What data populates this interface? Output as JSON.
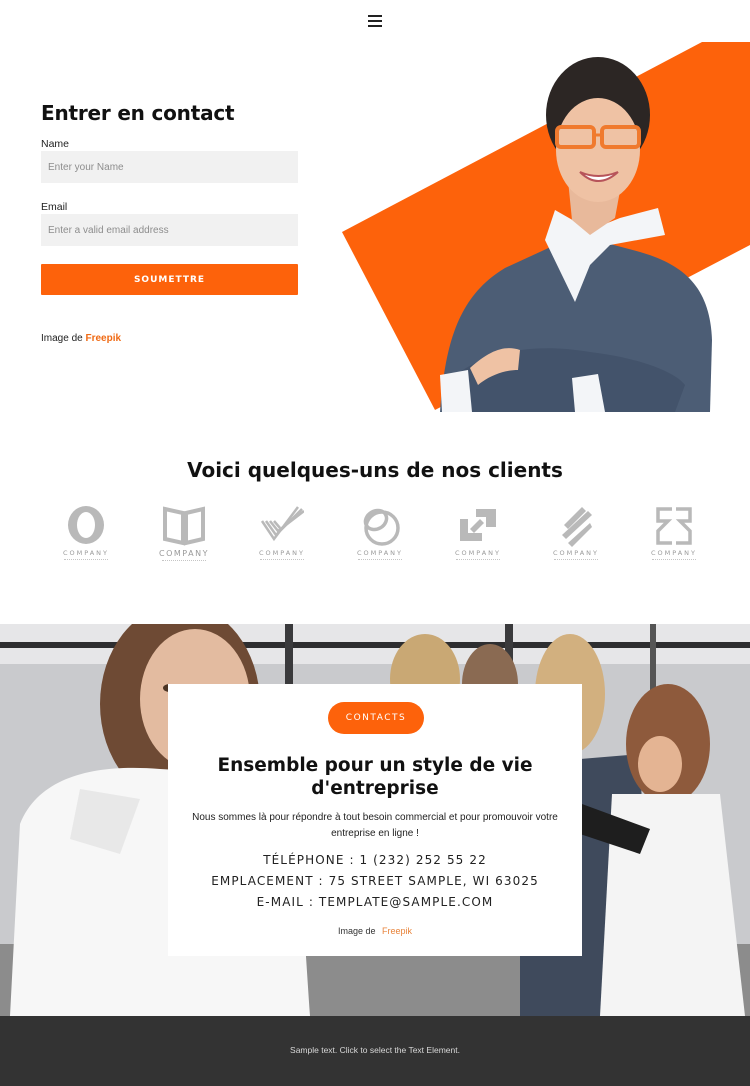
{
  "header": {
    "menu_icon": "hamburger-menu-icon"
  },
  "contact": {
    "title": "Entrer en contact",
    "name_label": "Name",
    "name_placeholder": "Enter your Name",
    "name_value": "",
    "email_label": "Email",
    "email_placeholder": "Enter a valid email address",
    "email_value": "",
    "submit_label": "SOUMETTRE",
    "credit_prefix": "Image de",
    "credit_link": "Freepik",
    "hero_image": "businesswoman-with-glasses-arms-crossed-on-orange-shape"
  },
  "clients": {
    "title": "Voici quelques-uns de nos clients",
    "logos": [
      {
        "icon": "oval-ring-logo-icon",
        "label": "COMPANY"
      },
      {
        "icon": "open-book-logo-icon",
        "label": "COMPANY"
      },
      {
        "icon": "striped-v-logo-icon",
        "label": "COMPANY"
      },
      {
        "icon": "interlocking-circles-logo-icon",
        "label": "COMPANY"
      },
      {
        "icon": "stepped-squares-logo-icon",
        "label": "COMPANY"
      },
      {
        "icon": "diagonal-bars-logo-icon",
        "label": "COMPANY"
      },
      {
        "icon": "mirrored-brackets-logo-icon",
        "label": "COMPANY"
      }
    ]
  },
  "banner": {
    "background_image": "woman-holding-sign-with-colleagues-in-office",
    "pill_label": "CONTACTS",
    "title": "Ensemble pour un style de vie d'entreprise",
    "description": "Nous sommes là pour répondre à tout besoin commercial et pour promouvoir votre entreprise en ligne !",
    "phone": "TÉLÉPHONE : 1 (232) 252 55 22",
    "location": "EMPLACEMENT : 75 STREET SAMPLE, WI 63025",
    "email": "E-MAIL : TEMPLATE@SAMPLE.COM",
    "credit_prefix": "Image de",
    "credit_link": "Freepik"
  },
  "footer": {
    "text": "Sample text. Click to select the Text Element."
  },
  "colors": {
    "accent": "#fd620b",
    "link": "#f06a14",
    "footer_bg": "#333333",
    "input_bg": "#f1f1f1"
  }
}
